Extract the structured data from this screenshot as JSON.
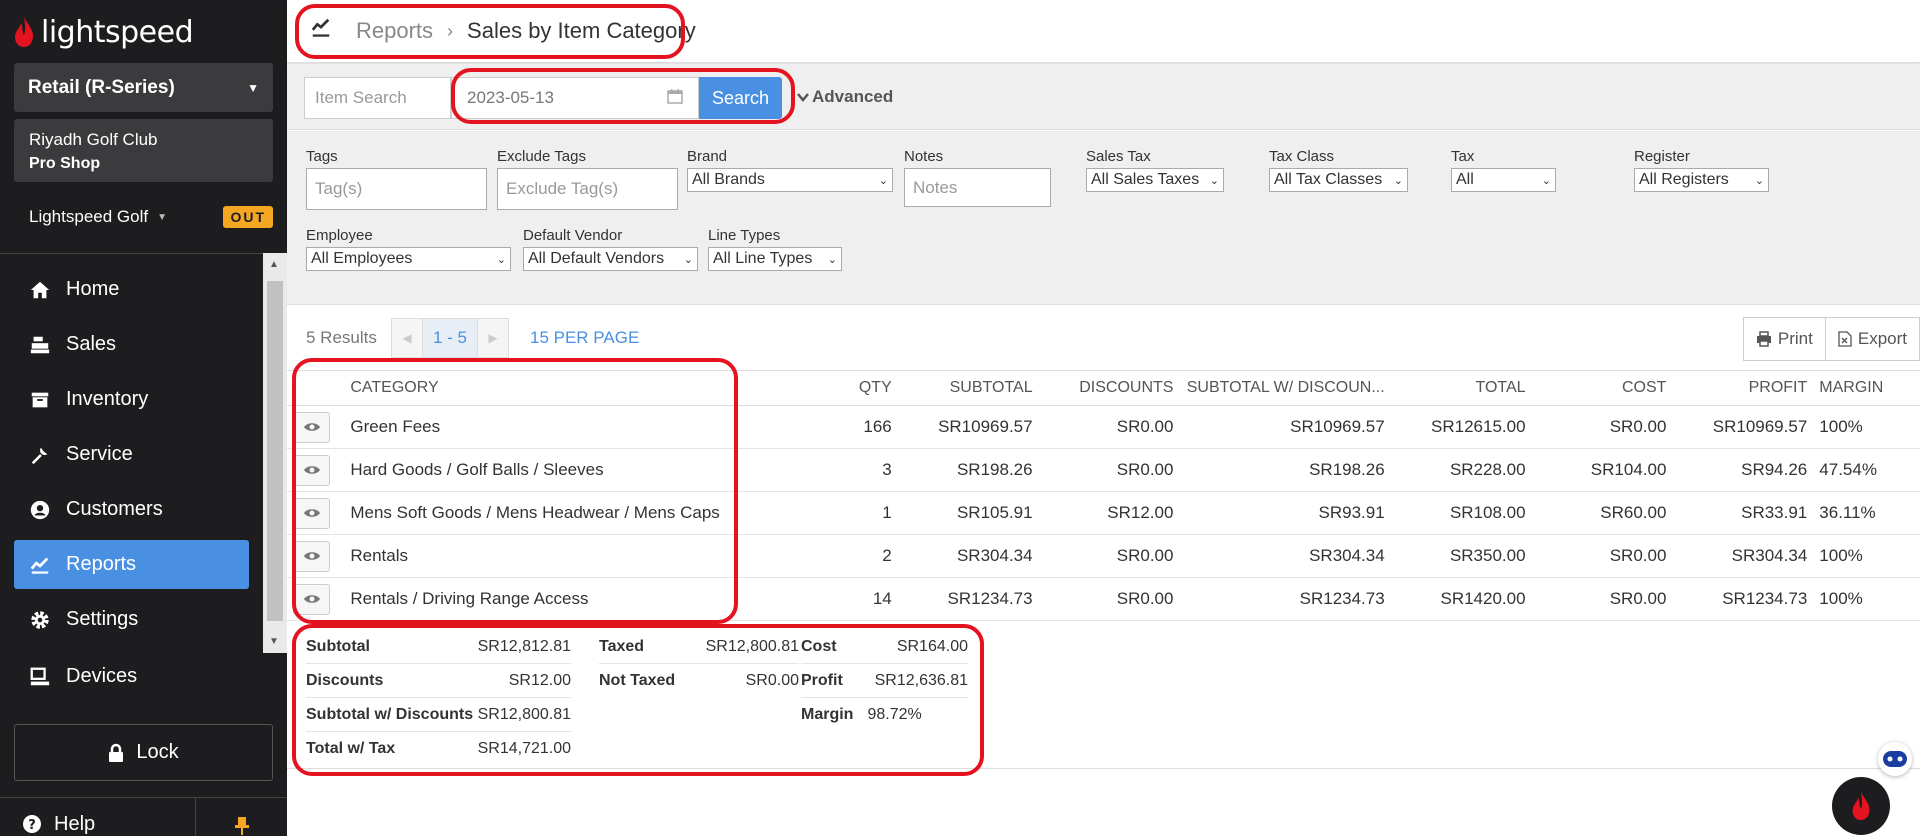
{
  "app": {
    "brand": "lightspeed"
  },
  "sidebar": {
    "store_select": "Retail (R-Series)",
    "shop_line1": "Riyadh Golf Club",
    "shop_line2": "Pro Shop",
    "account": "Lightspeed Golf",
    "out_badge": "OUT",
    "items": [
      {
        "label": "Home",
        "icon": "home-icon"
      },
      {
        "label": "Sales",
        "icon": "register-icon"
      },
      {
        "label": "Inventory",
        "icon": "inventory-icon"
      },
      {
        "label": "Service",
        "icon": "wrench-icon"
      },
      {
        "label": "Customers",
        "icon": "user-icon"
      },
      {
        "label": "Reports",
        "icon": "chart-icon",
        "active": true
      },
      {
        "label": "Settings",
        "icon": "gear-icon"
      },
      {
        "label": "Devices",
        "icon": "monitor-icon"
      }
    ],
    "lock_label": "Lock",
    "help_label": "Help"
  },
  "header": {
    "parent": "Reports",
    "separator": "›",
    "current": "Sales by Item Category"
  },
  "search": {
    "item_search_placeholder": "Item Search",
    "date_value": "2023-05-13",
    "search_button": "Search",
    "advanced_label": "Advanced"
  },
  "filters": {
    "tags": {
      "label": "Tags",
      "placeholder": "Tag(s)"
    },
    "exclude_tags": {
      "label": "Exclude Tags",
      "placeholder": "Exclude Tag(s)"
    },
    "brand": {
      "label": "Brand",
      "value": "All Brands"
    },
    "notes": {
      "label": "Notes",
      "placeholder": "Notes"
    },
    "sales_tax": {
      "label": "Sales Tax",
      "value": "All Sales Taxes"
    },
    "tax_class": {
      "label": "Tax Class",
      "value": "All Tax Classes"
    },
    "tax": {
      "label": "Tax",
      "value": "All"
    },
    "register": {
      "label": "Register",
      "value": "All Registers"
    },
    "employee": {
      "label": "Employee",
      "value": "All Employees"
    },
    "default_vendor": {
      "label": "Default Vendor",
      "value": "All Default Vendors"
    },
    "line_types": {
      "label": "Line Types",
      "value": "All Line Types"
    }
  },
  "results": {
    "count": "5 Results",
    "page_range": "1 - 5",
    "per_page": "15 PER PAGE",
    "print_label": "Print",
    "export_label": "Export"
  },
  "table": {
    "headers": [
      "CATEGORY",
      "QTY",
      "SUBTOTAL",
      "DISCOUNTS",
      "SUBTOTAL W/ DISCOUN...",
      "TOTAL",
      "COST",
      "PROFIT",
      "MARGIN"
    ],
    "rows": [
      [
        "Green Fees",
        "166",
        "SR10969.57",
        "SR0.00",
        "SR10969.57",
        "SR12615.00",
        "SR0.00",
        "SR10969.57",
        "100%"
      ],
      [
        "Hard Goods / Golf Balls / Sleeves",
        "3",
        "SR198.26",
        "SR0.00",
        "SR198.26",
        "SR228.00",
        "SR104.00",
        "SR94.26",
        "47.54%"
      ],
      [
        "Mens Soft Goods / Mens Headwear / Mens Caps",
        "1",
        "SR105.91",
        "SR12.00",
        "SR93.91",
        "SR108.00",
        "SR60.00",
        "SR33.91",
        "36.11%"
      ],
      [
        "Rentals",
        "2",
        "SR304.34",
        "SR0.00",
        "SR304.34",
        "SR350.00",
        "SR0.00",
        "SR304.34",
        "100%"
      ],
      [
        "Rentals / Driving Range Access",
        "14",
        "SR1234.73",
        "SR0.00",
        "SR1234.73",
        "SR1420.00",
        "SR0.00",
        "SR1234.73",
        "100%"
      ]
    ]
  },
  "summary": {
    "subtotal": {
      "label": "Subtotal",
      "value": "SR12,812.81"
    },
    "discounts": {
      "label": "Discounts",
      "value": "SR12.00"
    },
    "subtotal_w_discounts": {
      "label": "Subtotal w/ Discounts",
      "value": "SR12,800.81"
    },
    "total_w_tax": {
      "label": "Total w/ Tax",
      "value": "SR14,721.00"
    },
    "taxed": {
      "label": "Taxed",
      "value": "SR12,800.81"
    },
    "not_taxed": {
      "label": "Not Taxed",
      "value": "SR0.00"
    },
    "cost": {
      "label": "Cost",
      "value": "SR164.00"
    },
    "profit": {
      "label": "Profit",
      "value": "SR12,636.81"
    },
    "margin": {
      "label": "Margin",
      "value": "98.72%"
    }
  },
  "colors": {
    "accent": "#4a90e2",
    "sidebar_bg": "#1d1d1f",
    "highlight": "#e3131f",
    "badge": "#f5a623"
  }
}
